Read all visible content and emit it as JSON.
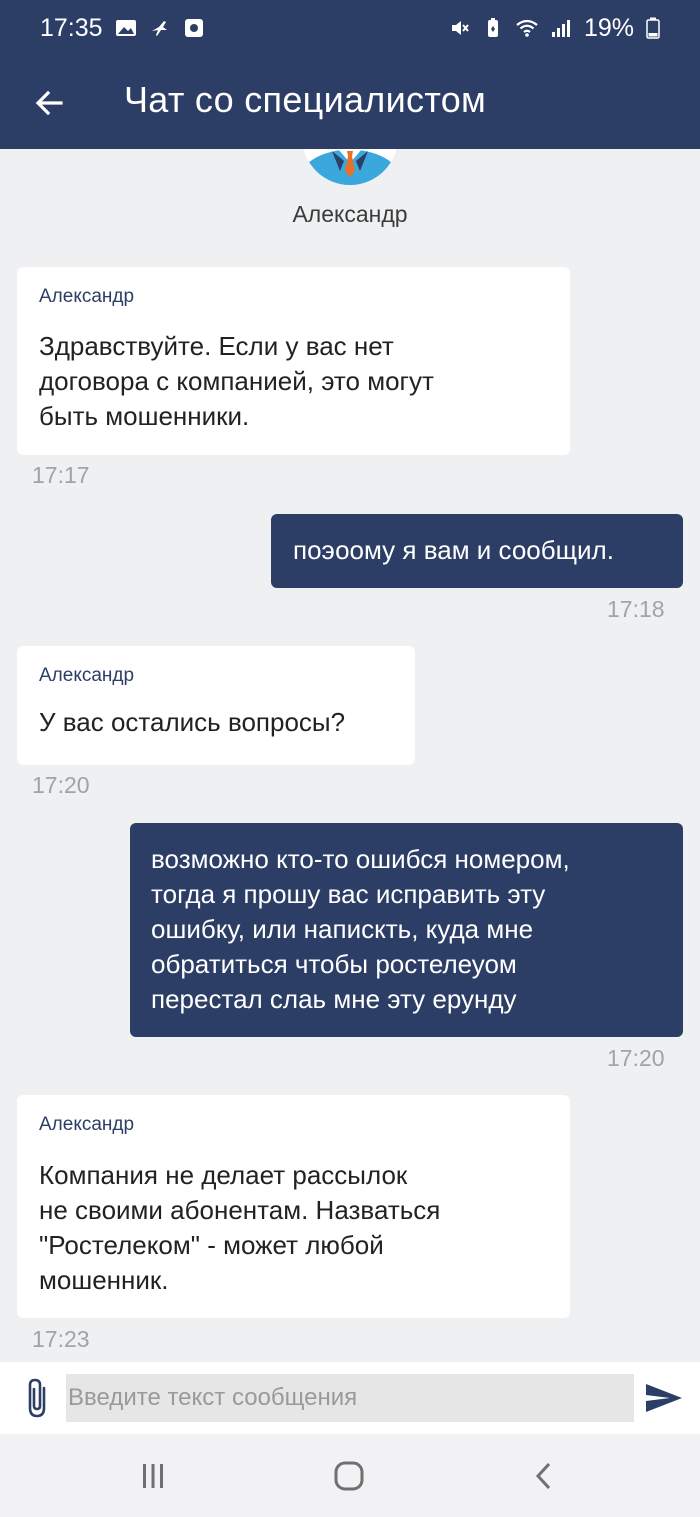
{
  "status_bar": {
    "time": "17:35",
    "battery": "19%"
  },
  "header": {
    "title": "Чат со специалистом"
  },
  "agent": {
    "name": "Александр"
  },
  "messages": [
    {
      "direction": "in",
      "sender": "Александр",
      "text": "Здравствуйте. Если у вас нет\nдоговора с компанией, это могут\nбыть мошенники.",
      "time": "17:17"
    },
    {
      "direction": "out",
      "text": "поэоому я вам и сообщил.",
      "time": "17:18"
    },
    {
      "direction": "in",
      "sender": "Александр",
      "text": "У вас остались вопросы?",
      "time": "17:20"
    },
    {
      "direction": "out",
      "text": "возможно кто-то ошибся номером,\nтогда я прошу вас исправить эту\nошибку, или напискть, куда мне\nобратиться чтобы ростелеуом\nперестал слаь мне эту ерунду",
      "time": "17:20"
    },
    {
      "direction": "in",
      "sender": "Александр",
      "text": "Компания не делает рассылок\nне своими абонентам. Назваться\n\"Ростелеком\" - может любой\nмошенник.",
      "time": "17:23"
    }
  ],
  "composer": {
    "placeholder": "Введите текст сообщения",
    "value": ""
  },
  "colors": {
    "brand": "#2c3e66",
    "chat_bg": "#eef0f2",
    "incoming_bubble": "#ffffff",
    "time_text": "#a0a4a8"
  }
}
